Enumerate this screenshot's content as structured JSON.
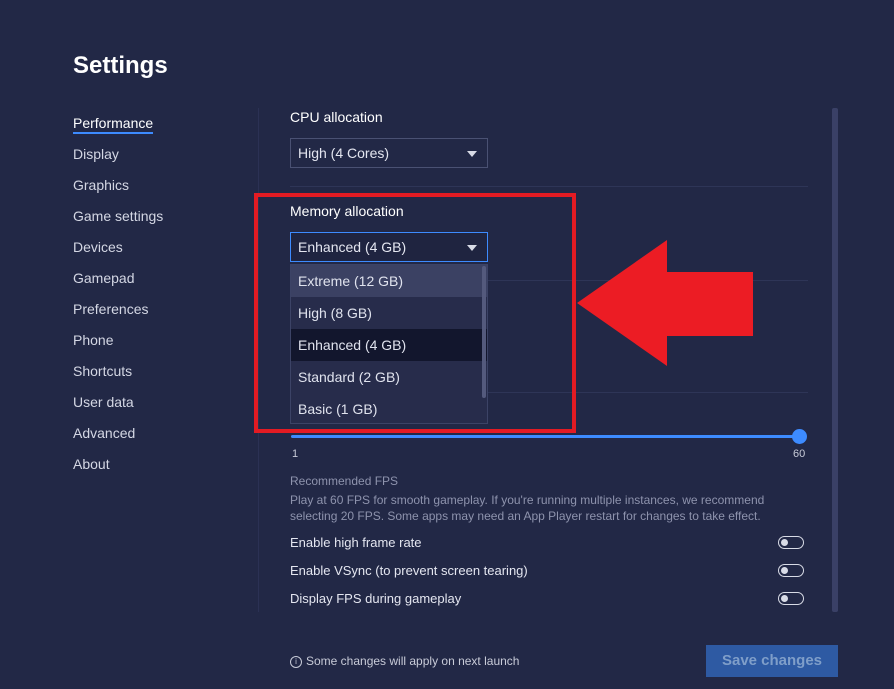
{
  "title": "Settings",
  "nav": [
    "Performance",
    "Display",
    "Graphics",
    "Game settings",
    "Devices",
    "Gamepad",
    "Preferences",
    "Phone",
    "Shortcuts",
    "User data",
    "Advanced",
    "About"
  ],
  "nav_active": "Performance",
  "cpu": {
    "label": "CPU allocation",
    "value": "High (4 Cores)"
  },
  "memory": {
    "label": "Memory allocation",
    "value": "Enhanced (4 GB)",
    "options": [
      "Extreme (12 GB)",
      "High (8 GB)",
      "Enhanced (4 GB)",
      "Standard (2 GB)",
      "Basic (1 GB)"
    ],
    "hovered": "Extreme (12 GB)",
    "selected": "Enhanced (4 GB)"
  },
  "fps": {
    "min_label": "1",
    "max_label": "60",
    "value": 60,
    "recommended_title": "Recommended FPS",
    "recommended_text": "Play at 60 FPS for smooth gameplay. If you're running multiple instances, we recommend selecting 20 FPS. Some apps may need an App Player restart for changes to take effect."
  },
  "toggles": [
    {
      "label": "Enable high frame rate",
      "on": false
    },
    {
      "label": "Enable VSync (to prevent screen tearing)",
      "on": false
    },
    {
      "label": "Display FPS during gameplay",
      "on": false
    }
  ],
  "footer": {
    "info_icon": "i",
    "note": "Some changes will apply on next launch",
    "save_label": "Save changes"
  },
  "colors": {
    "background": "#222846",
    "accent": "#3d8bff",
    "highlight": "#e31b23"
  }
}
